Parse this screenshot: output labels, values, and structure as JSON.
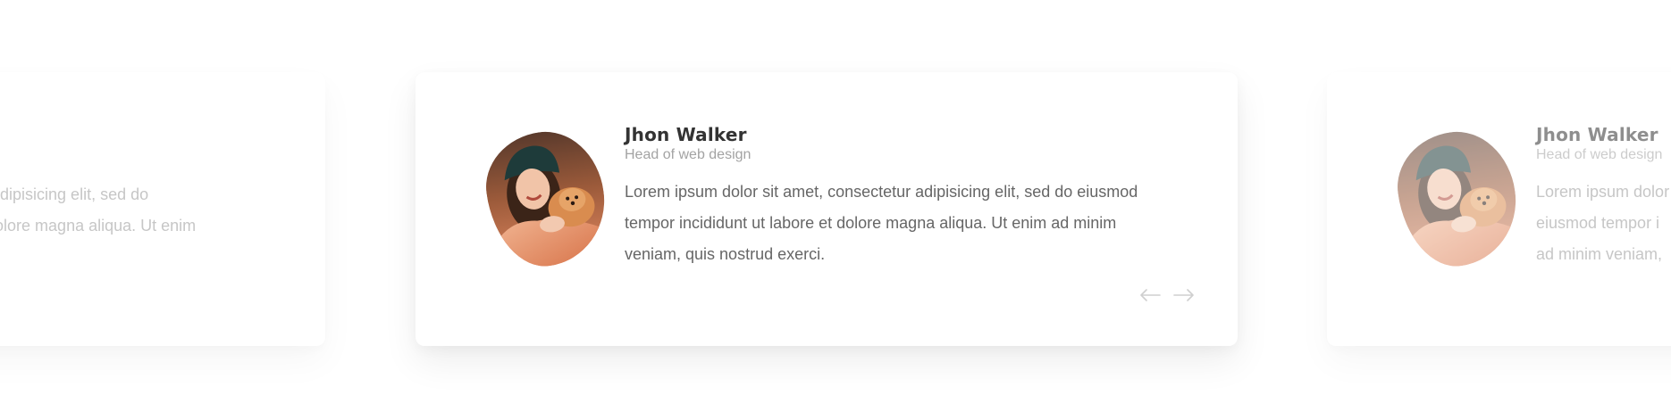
{
  "testimonials": [
    {
      "name": "Jhon Walker",
      "role": "Head of web design",
      "quote": "Lorem ipsum dolor sit amet, consectetur adipisicing elit, sed do eiusmod tempor incididunt ut labore et dolore magna aliqua. Ut enim ad minim veniam, quis nostrud exerci."
    }
  ],
  "left_card": {
    "line1": "tur adipisicing elit, sed do",
    "line2": "et dolore magna aliqua. Ut enim"
  },
  "right_card": {
    "name": "Jhon Walker",
    "role": "Head of web design",
    "line1": "Lorem ipsum dolor",
    "line2": "eiusmod tempor i",
    "line3": "ad minim veniam,"
  },
  "icons": {
    "prev": "arrow-left-icon",
    "next": "arrow-right-icon"
  },
  "colors": {
    "name": "#333333",
    "role": "#a3a3a3",
    "quote": "#666666",
    "arrow": "#cfcfcf"
  }
}
